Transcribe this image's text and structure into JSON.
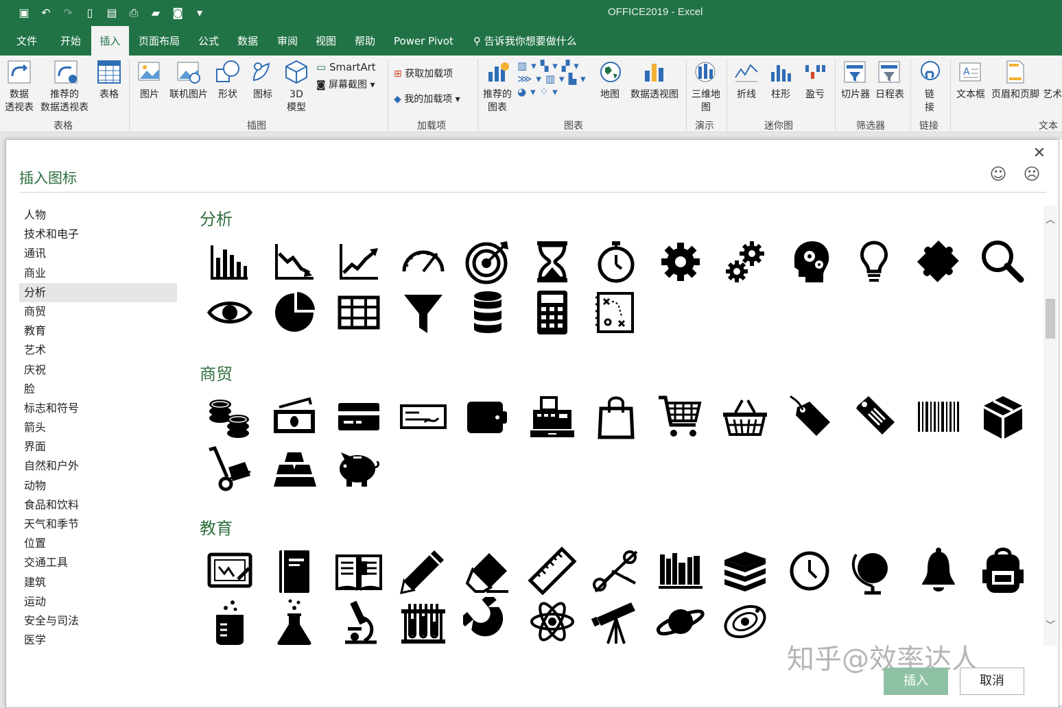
{
  "window": {
    "title": "OFFICE2019  -  Excel"
  },
  "tabs": [
    "文件",
    "开始",
    "插入",
    "页面布局",
    "公式",
    "数据",
    "审阅",
    "视图",
    "帮助",
    "Power Pivot"
  ],
  "active_tab": "插入",
  "tell_me": "告诉我你想要做什么",
  "ribbon": {
    "pivot": "数据\n透视表",
    "rec_pivot": "推荐的\n数据透视表",
    "table": "表格",
    "picture": "图片",
    "online_pic": "联机图片",
    "shapes": "形状",
    "icons": "图标",
    "model3d": "3D\n模型",
    "smartart": "SmartArt",
    "screenshot": "屏幕截图",
    "get_addins": "获取加载项",
    "my_addins": "我的加载项",
    "rec_charts": "推荐的\n图表",
    "maps": "地图",
    "pivot_chart": "数据透视图",
    "map3d": "三维地\n图",
    "line": "折线",
    "column": "柱形",
    "winloss": "盈亏",
    "slicer": "切片器",
    "timeline": "日程表",
    "link": "链\n接",
    "textbox": "文本框",
    "header_footer": "页眉和页脚",
    "art": "艺术",
    "groups": {
      "tables": "表格",
      "illustrations": "插图",
      "addins": "加载项",
      "charts": "图表",
      "tours": "演示",
      "sparklines": "迷你图",
      "filters": "筛选器",
      "links": "链接",
      "text": "文本"
    }
  },
  "dialog": {
    "title": "插入图标",
    "insert_label": "插入",
    "cancel_label": "取消",
    "categories": [
      "人物",
      "技术和电子",
      "通讯",
      "商业",
      "分析",
      "商贸",
      "教育",
      "艺术",
      "庆祝",
      "脸",
      "标志和符号",
      "箭头",
      "界面",
      "自然和户外",
      "动物",
      "食品和饮料",
      "天气和季节",
      "位置",
      "交通工具",
      "建筑",
      "运动",
      "安全与司法",
      "医学"
    ],
    "selected_category": "分析",
    "sections": [
      {
        "title": "分析",
        "icons": [
          "bar-chart-icon",
          "line-down-chart-icon",
          "line-up-chart-icon",
          "gauge-icon",
          "target-icon",
          "hourglass-icon",
          "stopwatch-icon",
          "gear-icon",
          "gears-icon",
          "head-gears-icon",
          "lightbulb-icon",
          "puzzle-icon",
          "magnifier-icon",
          "eye-icon",
          "pie-chart-icon",
          "table-grid-icon",
          "funnel-icon",
          "database-icon",
          "calculator-icon",
          "strategy-board-icon"
        ]
      },
      {
        "title": "商贸",
        "icons": [
          "coins-icon",
          "cash-icon",
          "credit-card-icon",
          "check-icon",
          "wallet-icon",
          "cash-register-icon",
          "shopping-bag-icon",
          "shopping-cart-icon",
          "basket-icon",
          "tag-icon",
          "price-tag-icon",
          "barcode-icon",
          "box-icon",
          "hand-truck-icon",
          "gold-bars-icon",
          "piggy-bank-icon"
        ]
      },
      {
        "title": "教育",
        "icons": [
          "blackboard-icon",
          "notebook-icon",
          "open-book-icon",
          "pencil-icon",
          "eraser-icon",
          "ruler-icon",
          "scissors-icon",
          "bookshelf-icon",
          "books-stack-icon",
          "clock-icon",
          "globe-icon",
          "bell-icon",
          "backpack-icon",
          "beaker-icon",
          "flask-icon",
          "microscope-icon",
          "test-tubes-icon",
          "magnet-icon",
          "atom-icon",
          "telescope-icon",
          "planet-icon",
          "galaxy-icon"
        ]
      }
    ]
  },
  "watermark": "知乎@效率达人",
  "colors": {
    "brand": "#217346",
    "heading": "#2f6f3f",
    "insert_btn": "#8fc2a4"
  }
}
